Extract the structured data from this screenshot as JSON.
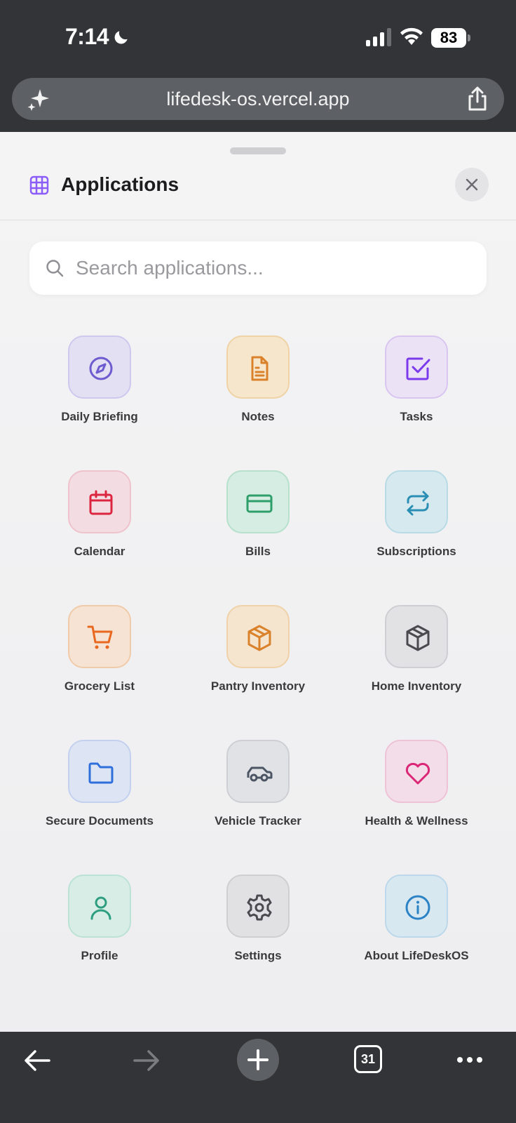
{
  "status_bar": {
    "time": "7:14",
    "battery": "83"
  },
  "browser": {
    "url": "lifedesk-os.vercel.app",
    "tab_count": "31"
  },
  "sheet": {
    "title": "Applications",
    "search_placeholder": "Search applications...",
    "apps": [
      {
        "label": "Daily Briefing",
        "icon": "compass-icon",
        "color": "#6d5bd0",
        "bg": "#e4e0f3",
        "border": "#cfc8ee"
      },
      {
        "label": "Notes",
        "icon": "document-icon",
        "color": "#d9822b",
        "bg": "#f6e6cc",
        "border": "#efd3a6"
      },
      {
        "label": "Tasks",
        "icon": "checkbox-icon",
        "color": "#7c3aed",
        "bg": "#ebe2f5",
        "border": "#d9c6f0"
      },
      {
        "label": "Calendar",
        "icon": "calendar-icon",
        "color": "#dc2640",
        "bg": "#f3dde2",
        "border": "#eec3cc"
      },
      {
        "label": "Bills",
        "icon": "credit-card-icon",
        "color": "#2e9e6b",
        "bg": "#d5ede2",
        "border": "#b7e0cd"
      },
      {
        "label": "Subscriptions",
        "icon": "repeat-icon",
        "color": "#2b8fb5",
        "bg": "#d6e9ee",
        "border": "#b9dbe5"
      },
      {
        "label": "Grocery List",
        "icon": "shopping-cart-icon",
        "color": "#e8681f",
        "bg": "#f6e3d3",
        "border": "#f0cba9"
      },
      {
        "label": "Pantry Inventory",
        "icon": "package-icon",
        "color": "#d9822b",
        "bg": "#f5e5cf",
        "border": "#efd2a9"
      },
      {
        "label": "Home Inventory",
        "icon": "box-icon",
        "color": "#4a4a4f",
        "bg": "#e2e2e4",
        "border": "#cfcfd3"
      },
      {
        "label": "Secure Documents",
        "icon": "folder-icon",
        "color": "#2f6fdc",
        "bg": "#dde4f3",
        "border": "#c3d1ef"
      },
      {
        "label": "Vehicle Tracker",
        "icon": "car-icon",
        "color": "#4b5563",
        "bg": "#e1e2e5",
        "border": "#cdcfd4"
      },
      {
        "label": "Health & Wellness",
        "icon": "heart-icon",
        "color": "#db2777",
        "bg": "#f3dde8",
        "border": "#eec3d6"
      },
      {
        "label": "Profile",
        "icon": "user-icon",
        "color": "#2e9e80",
        "bg": "#d8ede6",
        "border": "#bce2d6"
      },
      {
        "label": "Settings",
        "icon": "gear-icon",
        "color": "#4a4a4f",
        "bg": "#e1e1e3",
        "border": "#cfcfd2"
      },
      {
        "label": "About LifeDeskOS",
        "icon": "info-icon",
        "color": "#2b82c5",
        "bg": "#d8e8f1",
        "border": "#bcd8ea"
      }
    ]
  }
}
